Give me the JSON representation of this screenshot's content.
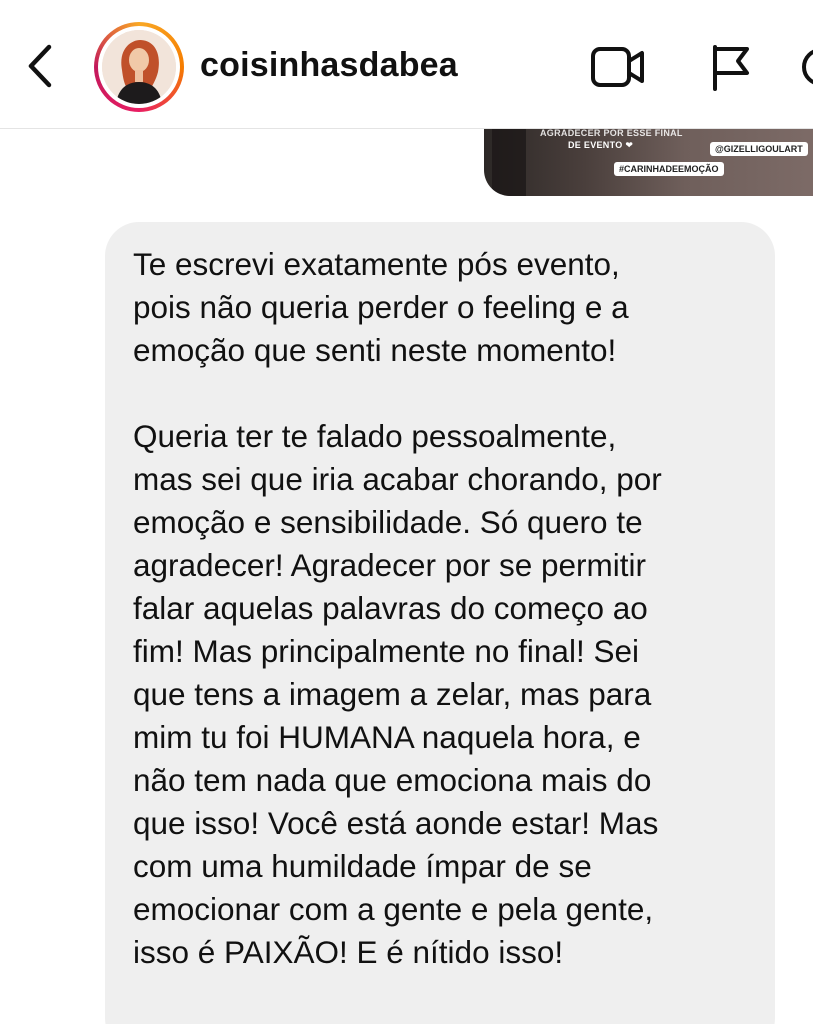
{
  "header": {
    "username": "coisinhasdabea",
    "back_icon": "chevron-left-icon",
    "video_icon": "video-camera-icon",
    "flag_icon": "flag-icon",
    "info_icon": "info-circle-icon"
  },
  "sent_image": {
    "line1": "AGRADECER POR ESSE FINAL",
    "line2": "DE EVENTO ❤",
    "tag1": "@GIZELLIGOULART",
    "tag2": "#CARINHADEEMOÇÃO"
  },
  "message": {
    "text": "Te escrevi exatamente pós evento,\npois não queria perder o feeling e a\nemoção que senti neste momento!\n\nQueria ter te falado pessoalmente,\nmas sei que iria acabar chorando, por\nemoção e sensibilidade. Só quero te\nagradecer! Agradecer por se permitir\nfalar aquelas palavras do começo ao\nfim! Mas principalmente no final! Sei\nque tens a imagem a zelar, mas para\nmim tu foi HUMANA naquela hora, e\nnão tem nada que emociona mais do\nque isso! Você está aonde estar! Mas\ncom uma humildade ímpar de se\nemocionar com a gente e pela gente,\nisso é PAIXÃO! E é nítido isso!"
  },
  "colors": {
    "bubble_background": "#efefef",
    "text": "#111111",
    "story_ring": "#e91e63"
  }
}
